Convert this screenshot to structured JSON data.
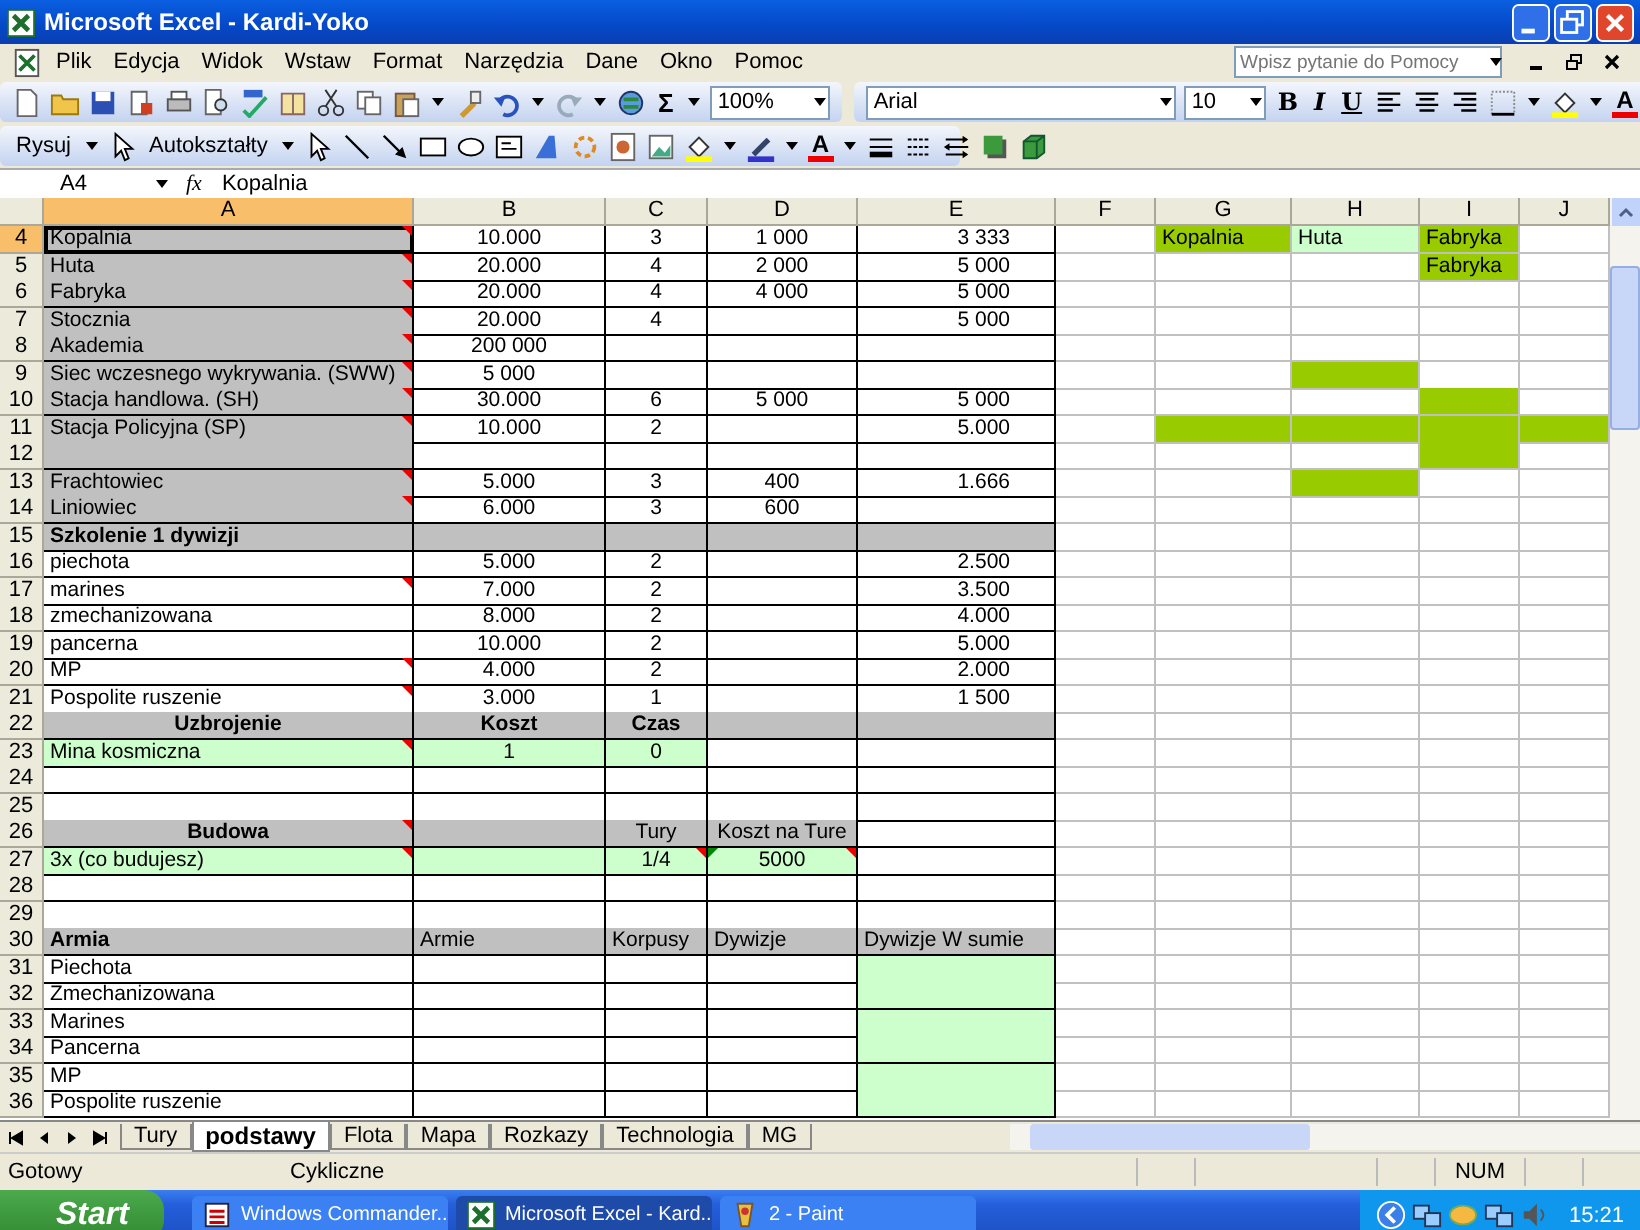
{
  "window": {
    "title": "Microsoft Excel - Kardi-Yoko"
  },
  "menu": [
    "Plik",
    "Edycja",
    "Widok",
    "Wstaw",
    "Format",
    "Narzędzia",
    "Dane",
    "Okno",
    "Pomoc"
  ],
  "help_search": {
    "placeholder": "Wpisz pytanie do Pomocy"
  },
  "standard_toolbar": {
    "autosum": "Σ",
    "zoom": "100%"
  },
  "formatting_toolbar": {
    "font": "Arial",
    "size": "10",
    "bold": "B",
    "italic": "I",
    "underline": "U",
    "font_color": "A"
  },
  "drawing_toolbar": {
    "draw": "Rysuj",
    "autoshapes": "Autokształty",
    "font_color": "A"
  },
  "formula_bar": {
    "name_box": "A4",
    "fx": "fx",
    "formula": "Kopalnia"
  },
  "columns": [
    {
      "label": "A",
      "selected": true
    },
    {
      "label": "B",
      "selected": false
    },
    {
      "label": "C",
      "selected": false
    },
    {
      "label": "D",
      "selected": false
    },
    {
      "label": "E",
      "selected": false
    },
    {
      "label": "F",
      "selected": false
    },
    {
      "label": "G",
      "selected": false
    },
    {
      "label": "H",
      "selected": false
    },
    {
      "label": "I",
      "selected": false
    },
    {
      "label": "J",
      "selected": false
    }
  ],
  "rows": [
    {
      "number": "4",
      "selected": true,
      "kind": "data",
      "cells": [
        {
          "text": "Kopalnia",
          "color": "#c0c0c0",
          "comment": true
        },
        {
          "text": "10.000"
        },
        {
          "text": "3"
        },
        {
          "text": "1 000"
        },
        {
          "text": "3 333"
        },
        {},
        {
          "text": "Kopalnia",
          "color": "#99cc00"
        },
        {
          "text": "Huta",
          "color": "#ccffcc"
        },
        {
          "text": "Fabryka",
          "color": "#99cc00"
        },
        {}
      ]
    },
    {
      "number": "5",
      "selected": false,
      "kind": "data",
      "cells": [
        {
          "text": "Huta",
          "color": "#c0c0c0",
          "comment": true
        },
        {
          "text": "20.000"
        },
        {
          "text": "4"
        },
        {
          "text": "2 000"
        },
        {
          "text": "5 000"
        },
        {},
        {},
        {},
        {
          "text": "Fabryka",
          "color": "#99cc00"
        },
        {}
      ]
    },
    {
      "number": "6",
      "selected": false,
      "kind": "data",
      "cells": [
        {
          "text": "Fabryka",
          "color": "#c0c0c0",
          "comment": true
        },
        {
          "text": "20.000"
        },
        {
          "text": "4"
        },
        {
          "text": "4 000"
        },
        {
          "text": "5 000"
        },
        {},
        {},
        {},
        {},
        {}
      ]
    },
    {
      "number": "7",
      "selected": false,
      "kind": "data",
      "cells": [
        {
          "text": "Stocznia",
          "color": "#c0c0c0",
          "comment": true
        },
        {
          "text": "20.000"
        },
        {
          "text": "4"
        },
        {},
        {
          "text": "5 000"
        },
        {},
        {},
        {},
        {},
        {}
      ]
    },
    {
      "number": "8",
      "selected": false,
      "kind": "data",
      "cells": [
        {
          "text": "Akademia",
          "color": "#c0c0c0",
          "comment": true
        },
        {
          "text": "200 000"
        },
        {},
        {},
        {},
        {},
        {},
        {},
        {},
        {}
      ]
    },
    {
      "number": "9",
      "selected": false,
      "kind": "data",
      "cells": [
        {
          "text": "Siec wczesnego wykrywania. (SWW)",
          "color": "#c0c0c0",
          "comment": true
        },
        {
          "text": "5 000"
        },
        {},
        {},
        {},
        {},
        {},
        {
          "color": "#99cc00"
        },
        {},
        {}
      ]
    },
    {
      "number": "10",
      "selected": false,
      "kind": "data",
      "cells": [
        {
          "text": "Stacja handlowa. (SH)",
          "color": "#c0c0c0",
          "comment": true
        },
        {
          "text": "30.000"
        },
        {
          "text": "6"
        },
        {
          "text": "5 000"
        },
        {
          "text": "5 000"
        },
        {},
        {},
        {},
        {
          "color": "#99cc00"
        },
        {}
      ]
    },
    {
      "number": "11",
      "selected": false,
      "kind": "data",
      "cells": [
        {
          "text": "Stacja Policyjna (SP)",
          "color": "#c0c0c0",
          "comment": true
        },
        {
          "text": "10.000"
        },
        {
          "text": "2"
        },
        {},
        {
          "text": "5.000"
        },
        {},
        {
          "color": "#99cc00"
        },
        {
          "color": "#99cc00"
        },
        {
          "color": "#99cc00"
        },
        {
          "color": "#99cc00"
        }
      ]
    },
    {
      "number": "12",
      "selected": false,
      "kind": "data",
      "cells": [
        {
          "color": "#c0c0c0"
        },
        {},
        {},
        {},
        {},
        {},
        {},
        {},
        {
          "color": "#99cc00"
        },
        {}
      ]
    },
    {
      "number": "13",
      "selected": false,
      "kind": "data",
      "cells": [
        {
          "text": "Frachtowiec",
          "color": "#c0c0c0",
          "comment": true
        },
        {
          "text": "5.000"
        },
        {
          "text": "3"
        },
        {
          "text": "400"
        },
        {
          "text": "1.666"
        },
        {},
        {},
        {
          "color": "#99cc00"
        },
        {},
        {}
      ]
    },
    {
      "number": "14",
      "selected": false,
      "kind": "data",
      "cells": [
        {
          "text": "Liniowiec",
          "color": "#c0c0c0",
          "comment": true
        },
        {
          "text": "6.000"
        },
        {
          "text": "3"
        },
        {
          "text": "600"
        },
        {},
        {},
        {},
        {},
        {},
        {}
      ]
    },
    {
      "number": "15",
      "selected": false,
      "kind": "section",
      "cells": [
        {
          "text": "Szkolenie 1 dywizji",
          "bold": true,
          "color": "#c0c0c0"
        },
        {
          "color": "#c0c0c0"
        },
        {
          "color": "#c0c0c0"
        },
        {
          "color": "#c0c0c0"
        },
        {
          "color": "#c0c0c0"
        },
        {},
        {},
        {},
        {},
        {}
      ]
    },
    {
      "number": "16",
      "selected": false,
      "kind": "data",
      "cells": [
        {
          "text": "piechota"
        },
        {
          "text": "5.000"
        },
        {
          "text": "2"
        },
        {},
        {
          "text": "2.500"
        },
        {},
        {},
        {},
        {},
        {}
      ]
    },
    {
      "number": "17",
      "selected": false,
      "kind": "data",
      "cells": [
        {
          "text": "marines",
          "comment": true
        },
        {
          "text": "7.000"
        },
        {
          "text": "2"
        },
        {},
        {
          "text": "3.500"
        },
        {},
        {},
        {},
        {},
        {}
      ]
    },
    {
      "number": "18",
      "selected": false,
      "kind": "data",
      "cells": [
        {
          "text": "zmechanizowana"
        },
        {
          "text": "8.000"
        },
        {
          "text": "2"
        },
        {},
        {
          "text": "4.000"
        },
        {},
        {},
        {},
        {},
        {}
      ]
    },
    {
      "number": "19",
      "selected": false,
      "kind": "data",
      "cells": [
        {
          "text": "pancerna"
        },
        {
          "text": "10.000"
        },
        {
          "text": "2"
        },
        {},
        {
          "text": "5.000"
        },
        {},
        {},
        {},
        {},
        {}
      ]
    },
    {
      "number": "20",
      "selected": false,
      "kind": "data",
      "cells": [
        {
          "text": "MP",
          "comment": true
        },
        {
          "text": "4.000"
        },
        {
          "text": "2"
        },
        {},
        {
          "text": "2.000"
        },
        {},
        {},
        {},
        {},
        {}
      ]
    },
    {
      "number": "21",
      "selected": false,
      "kind": "data",
      "cells": [
        {
          "text": "Pospolite ruszenie",
          "comment": true
        },
        {
          "text": "3.000"
        },
        {
          "text": "1"
        },
        {},
        {
          "text": "1 500"
        },
        {},
        {},
        {},
        {},
        {}
      ]
    },
    {
      "number": "22",
      "selected": false,
      "kind": "header",
      "cells": [
        {
          "text": "Uzbrojenie",
          "bold": true,
          "color": "#c0c0c0"
        },
        {
          "text": "Koszt",
          "bold": true,
          "color": "#c0c0c0"
        },
        {
          "text": "Czas",
          "bold": true,
          "color": "#c0c0c0"
        },
        {
          "color": "#c0c0c0"
        },
        {
          "color": "#c0c0c0"
        },
        {},
        {},
        {},
        {},
        {}
      ]
    },
    {
      "number": "23",
      "selected": false,
      "kind": "data",
      "cells": [
        {
          "text": "Mina kosmiczna",
          "color": "#ccffcc",
          "comment": true
        },
        {
          "text": "1",
          "color": "#ccffcc"
        },
        {
          "text": "0",
          "color": "#ccffcc"
        },
        {},
        {},
        {},
        {},
        {},
        {},
        {}
      ]
    },
    {
      "number": "24",
      "selected": false,
      "kind": "data",
      "cells": [
        {},
        {},
        {},
        {},
        {},
        {},
        {},
        {},
        {},
        {}
      ]
    },
    {
      "number": "25",
      "selected": false,
      "kind": "data",
      "cells": [
        {},
        {},
        {},
        {},
        {},
        {},
        {},
        {},
        {},
        {}
      ]
    },
    {
      "number": "26",
      "selected": false,
      "kind": "header",
      "cells": [
        {
          "text": "Budowa",
          "bold": true,
          "color": "#c0c0c0",
          "comment": true
        },
        {
          "color": "#c0c0c0"
        },
        {
          "text": "Tury",
          "color": "#c0c0c0"
        },
        {
          "text": "Koszt na Ture",
          "color": "#c0c0c0"
        },
        {},
        {},
        {},
        {},
        {},
        {}
      ]
    },
    {
      "number": "27",
      "selected": false,
      "kind": "data",
      "cells": [
        {
          "text": "3x (co budujesz)",
          "color": "#ccffcc",
          "comment": true
        },
        {
          "color": "#ccffcc"
        },
        {
          "text": "1/4",
          "color": "#ccffcc",
          "comment": true
        },
        {
          "text": "5000",
          "color": "#ccffcc",
          "comment": true,
          "error": true
        },
        {},
        {},
        {},
        {},
        {},
        {}
      ]
    },
    {
      "number": "28",
      "selected": false,
      "kind": "data",
      "cells": [
        {},
        {},
        {},
        {},
        {},
        {},
        {},
        {},
        {},
        {}
      ]
    },
    {
      "number": "29",
      "selected": false,
      "kind": "data",
      "cells": [
        {},
        {},
        {},
        {},
        {},
        {},
        {},
        {},
        {},
        {}
      ]
    },
    {
      "number": "30",
      "selected": false,
      "kind": "section",
      "cells": [
        {
          "text": "Armia",
          "bold": true,
          "color": "#c0c0c0"
        },
        {
          "text": "Armie",
          "color": "#c0c0c0"
        },
        {
          "text": "Korpusy",
          "color": "#c0c0c0"
        },
        {
          "text": "Dywizje",
          "color": "#c0c0c0"
        },
        {
          "text": "Dywizje W sumie",
          "color": "#c0c0c0"
        },
        {},
        {},
        {},
        {},
        {}
      ]
    },
    {
      "number": "31",
      "selected": false,
      "kind": "data",
      "cells": [
        {
          "text": "Piechota"
        },
        {},
        {},
        {},
        {
          "color": "#ccffcc"
        },
        {},
        {},
        {},
        {},
        {}
      ]
    },
    {
      "number": "32",
      "selected": false,
      "kind": "data",
      "cells": [
        {
          "text": "Zmechanizowana"
        },
        {},
        {},
        {},
        {
          "color": "#ccffcc"
        },
        {},
        {},
        {},
        {},
        {}
      ]
    },
    {
      "number": "33",
      "selected": false,
      "kind": "data",
      "cells": [
        {
          "text": "Marines"
        },
        {},
        {},
        {},
        {
          "color": "#ccffcc"
        },
        {},
        {},
        {},
        {},
        {}
      ]
    },
    {
      "number": "34",
      "selected": false,
      "kind": "data",
      "cells": [
        {
          "text": "Pancerna"
        },
        {},
        {},
        {},
        {
          "color": "#ccffcc"
        },
        {},
        {},
        {},
        {},
        {}
      ]
    },
    {
      "number": "35",
      "selected": false,
      "kind": "data",
      "cells": [
        {
          "text": "MP"
        },
        {},
        {},
        {},
        {
          "color": "#ccffcc"
        },
        {},
        {},
        {},
        {},
        {}
      ]
    },
    {
      "number": "36",
      "selected": false,
      "kind": "data",
      "cells": [
        {
          "text": "Pospolite ruszenie"
        },
        {},
        {},
        {},
        {
          "color": "#ccffcc"
        },
        {},
        {},
        {},
        {},
        {}
      ]
    }
  ],
  "sheet_tabs": [
    {
      "label": "Tury",
      "selected": false
    },
    {
      "label": "podstawy",
      "selected": true
    },
    {
      "label": "Flota",
      "selected": false
    },
    {
      "label": "Mapa",
      "selected": false
    },
    {
      "label": "Rozkazy",
      "selected": false
    },
    {
      "label": "Technologia",
      "selected": false
    },
    {
      "label": "MG",
      "selected": false
    }
  ],
  "status_bar": {
    "mode": "Gotowy",
    "circular": "Cykliczne",
    "num": "NUM"
  },
  "taskbar": {
    "start": "Start",
    "tasks": [
      {
        "label": "Windows Commander...",
        "selected": false
      },
      {
        "label": "Microsoft Excel - Kard...",
        "selected": true
      },
      {
        "label": "2 - Paint",
        "selected": false
      }
    ],
    "clock": "15:21"
  }
}
